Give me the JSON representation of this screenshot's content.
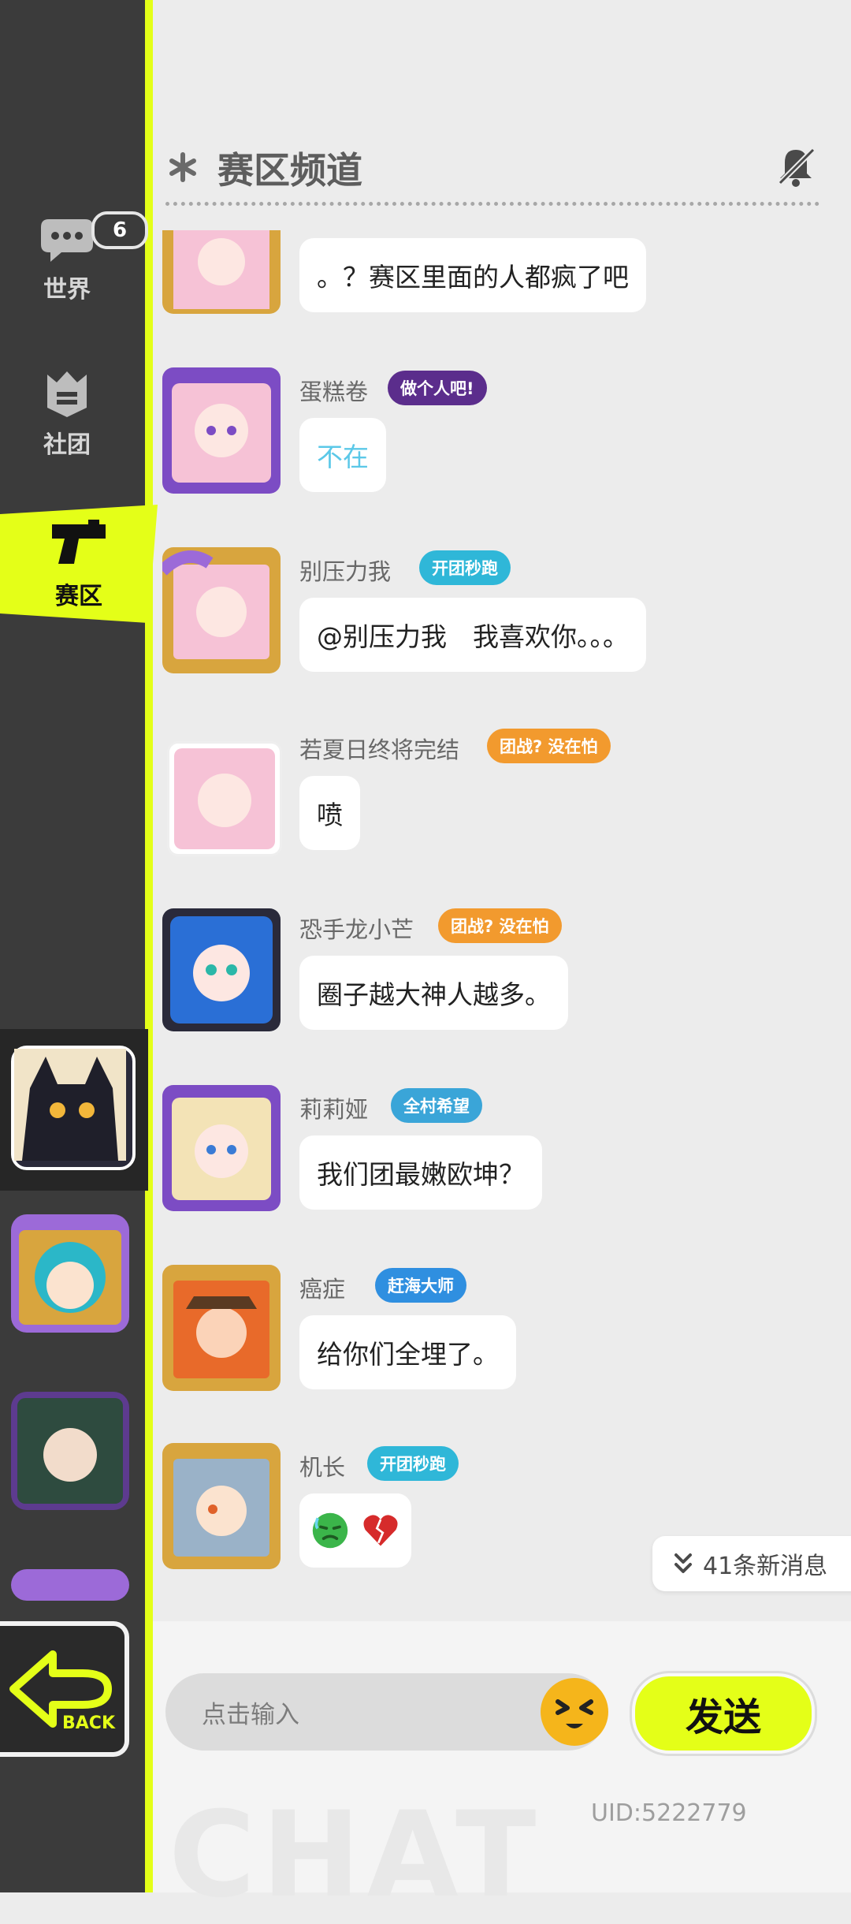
{
  "nav": {
    "world_label": "世界",
    "world_badge": "6",
    "club_label": "社团",
    "region_label": "赛区"
  },
  "header": {
    "title": "赛区频道"
  },
  "messages": [
    {
      "name": "",
      "tag": "",
      "text": "。？赛区里面的人都疯了吧"
    },
    {
      "name": "蛋糕卷",
      "tag": "做个人吧!",
      "text": "不在"
    },
    {
      "name": "别压力我",
      "tag": "开团秒跑",
      "text": "@别压力我　我喜欢你。。。"
    },
    {
      "name": "若夏日终将完结",
      "tag": "团战? 没在怕",
      "text": "喷"
    },
    {
      "name": "恐手龙小芒",
      "tag": "团战? 没在怕",
      "text": "圈子越大神人越多。"
    },
    {
      "name": "莉莉娅",
      "tag": "全村希望",
      "text": "我们团最嫩欧坤？"
    },
    {
      "name": "癌症",
      "tag": "赶海大师",
      "text": "给你们全埋了。"
    },
    {
      "name": "机长",
      "tag": "开团秒跑",
      "text": ""
    }
  ],
  "new_messages": "41条新消息",
  "input": {
    "placeholder": "点击输入"
  },
  "send_label": "发送",
  "uid": "UID:5222779",
  "back_label": "BACK",
  "watermark": "CHAT",
  "colors": {
    "accent": "#e4ff18",
    "sidebar": "#3b3b3b",
    "background": "#ececec"
  }
}
